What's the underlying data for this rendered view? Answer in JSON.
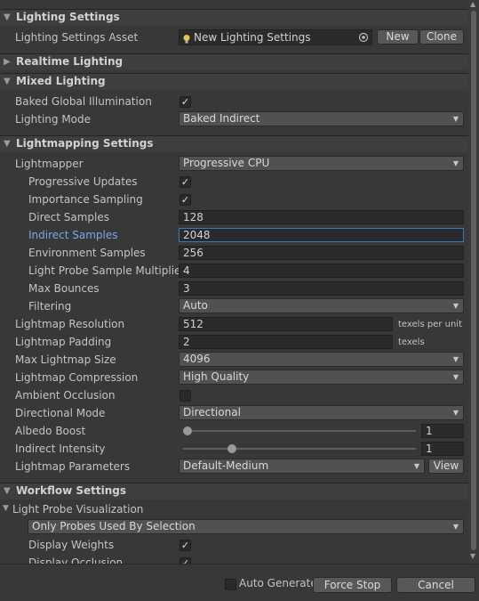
{
  "sections": {
    "lighting_settings": "Lighting Settings",
    "realtime_lighting": "Realtime Lighting",
    "mixed_lighting": "Mixed Lighting",
    "lightmapping_settings": "Lightmapping Settings",
    "workflow_settings": "Workflow Settings"
  },
  "asset": {
    "label": "Lighting Settings Asset",
    "value": "New Lighting Settings",
    "new_button": "New",
    "clone_button": "Clone"
  },
  "mixed": {
    "baked_gi_label": "Baked Global Illumination",
    "baked_gi_checked": true,
    "lighting_mode_label": "Lighting Mode",
    "lighting_mode_value": "Baked Indirect"
  },
  "lightmapping": {
    "lightmapper_label": "Lightmapper",
    "lightmapper_value": "Progressive CPU",
    "progressive_updates_label": "Progressive Updates",
    "progressive_updates_checked": true,
    "importance_sampling_label": "Importance Sampling",
    "importance_sampling_checked": true,
    "direct_samples_label": "Direct Samples",
    "direct_samples_value": "128",
    "indirect_samples_label": "Indirect Samples",
    "indirect_samples_value": "2048",
    "environment_samples_label": "Environment Samples",
    "environment_samples_value": "256",
    "light_probe_multiplier_label": "Light Probe Sample Multiplier",
    "light_probe_multiplier_value": "4",
    "max_bounces_label": "Max Bounces",
    "max_bounces_value": "3",
    "filtering_label": "Filtering",
    "filtering_value": "Auto",
    "resolution_label": "Lightmap Resolution",
    "resolution_value": "512",
    "resolution_unit": "texels per unit",
    "padding_label": "Lightmap Padding",
    "padding_value": "2",
    "padding_unit": "texels",
    "max_size_label": "Max Lightmap Size",
    "max_size_value": "4096",
    "compression_label": "Lightmap Compression",
    "compression_value": "High Quality",
    "ambient_occlusion_label": "Ambient Occlusion",
    "ambient_occlusion_checked": false,
    "directional_mode_label": "Directional Mode",
    "directional_mode_value": "Directional",
    "albedo_boost_label": "Albedo Boost",
    "albedo_boost_value": "1",
    "albedo_boost_fraction": 0.0,
    "indirect_intensity_label": "Indirect Intensity",
    "indirect_intensity_value": "1",
    "indirect_intensity_fraction": 0.2,
    "parameters_label": "Lightmap Parameters",
    "parameters_value": "Default-Medium",
    "view_button": "View"
  },
  "workflow": {
    "probe_vis_label": "Light Probe Visualization",
    "probe_vis_value": "Only Probes Used By Selection",
    "display_weights_label": "Display Weights",
    "display_weights_checked": true,
    "display_occlusion_label": "Display Occlusion",
    "display_occlusion_checked": true
  },
  "footer": {
    "auto_generate_label": "Auto Generate",
    "auto_generate_checked": false,
    "force_stop_button": "Force Stop",
    "cancel_button": "Cancel"
  },
  "glyphs": {
    "expanded": "▼",
    "collapsed": "▶",
    "check": "✓",
    "caret": "▼"
  },
  "colors": {
    "background": "#383838",
    "highlight_label": "#7ca6e6",
    "focus_border": "#3a79bb"
  }
}
